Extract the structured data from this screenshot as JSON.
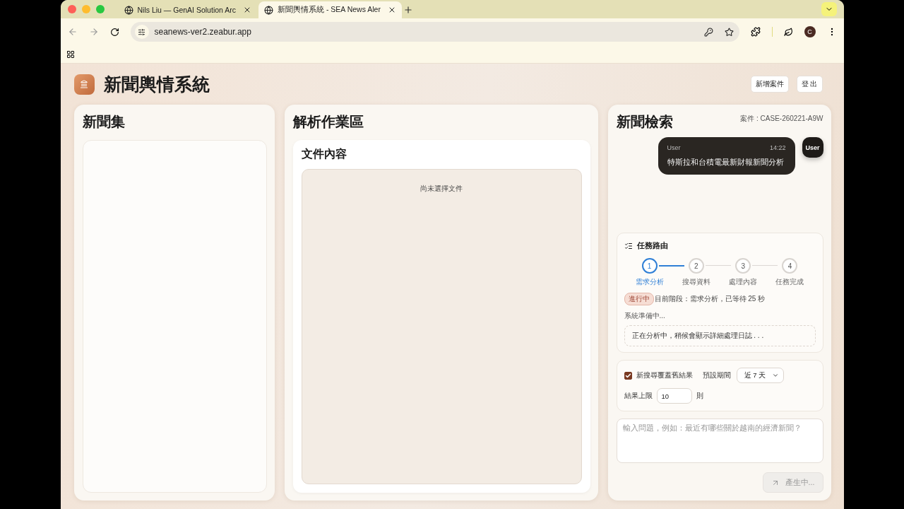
{
  "browser": {
    "tabs": [
      {
        "title": "Nils Liu — GenAI Solution Arc",
        "selected": false
      },
      {
        "title": "新聞輿情系統 - SEA News Aler",
        "selected": true
      }
    ],
    "url": "seanews-ver2.zeabur.app",
    "profile_initial": "C"
  },
  "app": {
    "title": "新聞輿情系統",
    "header_buttons": [
      "新增案件",
      "登 出"
    ]
  },
  "news_panel": {
    "title": "新聞集"
  },
  "workspace_panel": {
    "title": "解析作業區",
    "document": {
      "title": "文件內容",
      "empty_text": "尚未選擇文件"
    }
  },
  "search_panel": {
    "title": "新聞檢索",
    "case_label": "案件 : CASE-260221-A9W",
    "messages": [
      {
        "sender": "User",
        "time": "14:22",
        "text": "特斯拉和台積電最新財報新聞分析",
        "avatar": "User"
      }
    ],
    "routing": {
      "title": "任務路由",
      "steps": [
        {
          "number": "1",
          "label": "需求分析",
          "selected": true
        },
        {
          "number": "2",
          "label": "搜尋資料",
          "selected": false
        },
        {
          "number": "3",
          "label": "處理內容",
          "selected": false
        },
        {
          "number": "4",
          "label": "任務完成",
          "selected": false
        }
      ],
      "status_badge": "進行中",
      "status_text": "目前階段：需求分析，已等待 25 秒",
      "sub_status": "系統準備中...",
      "log_text": "正在分析中，稍候會顯示詳細處理日誌 . . ."
    },
    "options": {
      "overwrite": {
        "label": "新搜尋覆蓋舊結果",
        "checked": true
      },
      "period_label": "預設期間",
      "period_value": "近 7 天",
      "limit_label": "結果上限",
      "limit_value": "10",
      "limit_unit": "則"
    },
    "query": {
      "placeholder": "輸入問題，例如：最近有哪些關於越南的經濟新聞？"
    },
    "submit": {
      "label": "產生中...",
      "disabled": true
    }
  }
}
